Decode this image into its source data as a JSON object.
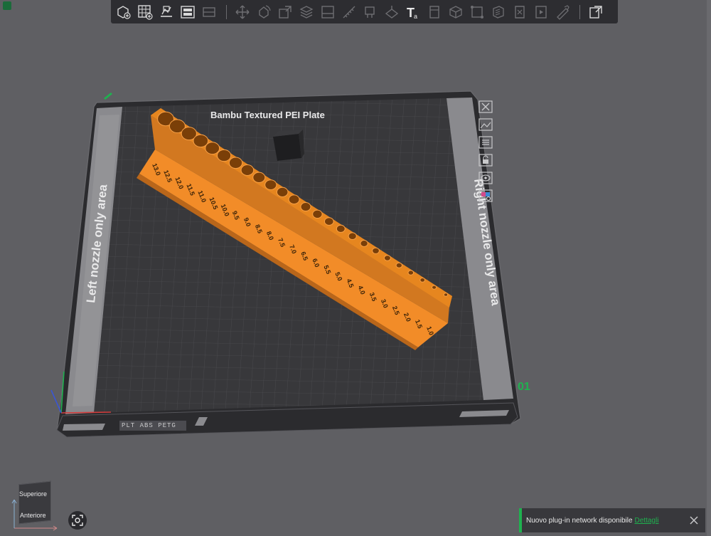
{
  "toolbar": {
    "icons": [
      "add-object-icon",
      "add-plate-icon",
      "auto-orient-icon",
      "arrange-icon",
      "split-icon",
      "move-icon",
      "rotate-icon",
      "scale-icon",
      "layer-split-icon",
      "cut-icon",
      "measure-icon",
      "paint-support-icon",
      "text-icon",
      "paint-icon",
      "mesh-boolean-icon",
      "fix-model-icon",
      "assembly-icon",
      "variable-height-icon",
      "seam-icon",
      "brim-ears-icon",
      "view-icon"
    ],
    "text_tool_label": "T"
  },
  "plate": {
    "title": "Bambu Textured PEI Plate",
    "left_area_label": "Left nozzle only area",
    "right_area_label": "Right nozzle only area",
    "plate_number": "01",
    "filament_label": "PLT ABS PETG"
  },
  "model": {
    "color": "#f28c28",
    "hole_sizes": [
      "13.0",
      "12.5",
      "12.0",
      "11.5",
      "11.0",
      "10.5",
      "10.0",
      "9.5",
      "9.0",
      "8.5",
      "8.0",
      "7.5",
      "7.0",
      "6.5",
      "6.0",
      "5.5",
      "5.0",
      "4.5",
      "4.0",
      "3.5",
      "3.0",
      "2.5",
      "2.0",
      "1.5",
      "1.0"
    ]
  },
  "plate_side_icons": [
    "close-icon",
    "image-icon",
    "list-icon",
    "lock-icon",
    "eye-icon",
    "settings-icon"
  ],
  "view_cube": {
    "top_label": "Superiore",
    "front_label": "Anteriore"
  },
  "notification": {
    "message": "Nuovo plug-in network disponibile",
    "link": "Dettagli"
  }
}
